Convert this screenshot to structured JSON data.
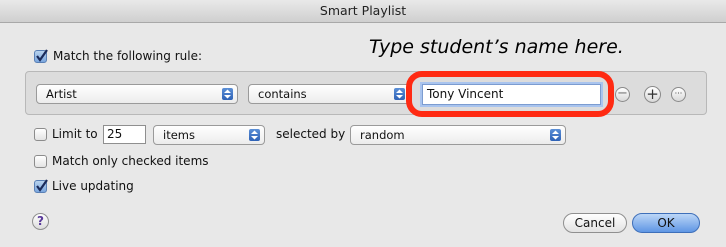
{
  "window": {
    "title": "Smart Playlist"
  },
  "annotation": {
    "text": "Type student’s name here."
  },
  "match_rule": {
    "label": "Match the following rule:",
    "checked": true
  },
  "rule": {
    "field": "Artist",
    "operator": "contains",
    "value": "Tony Vincent",
    "remove_symbol": "−",
    "add_symbol": "+",
    "more_symbol": "···"
  },
  "limit": {
    "label": "Limit to",
    "checked": false,
    "count": "25",
    "unit": "items",
    "selected_by_label": "selected by",
    "selected_by": "random"
  },
  "match_checked": {
    "label": "Match only checked items",
    "checked": false
  },
  "live_updating": {
    "label": "Live updating",
    "checked": true
  },
  "footer": {
    "help_symbol": "?",
    "cancel_label": "Cancel",
    "ok_label": "OK"
  },
  "colors": {
    "highlight": "#ff2a12",
    "accent": "#5f96e4"
  }
}
